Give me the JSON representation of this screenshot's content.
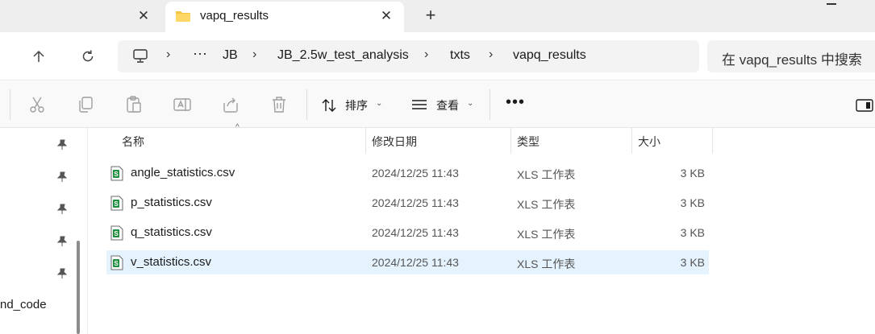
{
  "tabs": {
    "active_title": "vapq_results"
  },
  "breadcrumb": {
    "items": [
      "JB",
      "JB_2.5w_test_analysis",
      "txts",
      "vapq_results"
    ]
  },
  "search": {
    "placeholder": "在 vapq_results 中搜索"
  },
  "commandbar": {
    "sort_label": "排序",
    "view_label": "查看"
  },
  "navpane": {
    "partial_label": "nd_code"
  },
  "columns": {
    "name": "名称",
    "modified": "修改日期",
    "type": "类型",
    "size": "大小"
  },
  "files": [
    {
      "name": "angle_statistics.csv",
      "modified": "2024/12/25 11:43",
      "type": "XLS 工作表",
      "size": "3 KB"
    },
    {
      "name": "p_statistics.csv",
      "modified": "2024/12/25 11:43",
      "type": "XLS 工作表",
      "size": "3 KB"
    },
    {
      "name": "q_statistics.csv",
      "modified": "2024/12/25 11:43",
      "type": "XLS 工作表",
      "size": "3 KB"
    },
    {
      "name": "v_statistics.csv",
      "modified": "2024/12/25 11:43",
      "type": "XLS 工作表",
      "size": "3 KB"
    }
  ],
  "colors": {
    "selected_row": "#e5f3ff",
    "folder_yellow": "#f5c542",
    "csv_green": "#1e8e3e"
  }
}
